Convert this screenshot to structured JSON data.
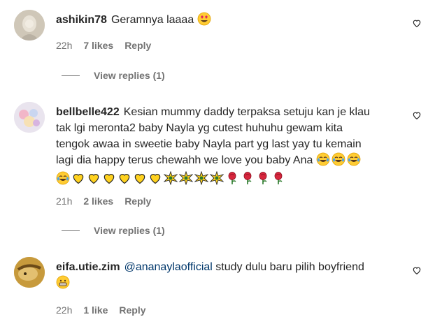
{
  "comments": [
    {
      "username": "ashikin78",
      "text": "Geramnya laaaa",
      "time": "22h",
      "likes": "7 likes",
      "reply": "Reply",
      "view_replies": "View replies (1)"
    },
    {
      "username": "bellbelle422",
      "text": "Kesian mummy daddy terpaksa setuju kan je klau tak lgi meronta2 baby Nayla yg cutest huhuhu gewam kita tengok awaa in sweetie baby Nayla part yg last yay tu kemain lagi dia happy terus chewahh we love you baby Ana",
      "time": "21h",
      "likes": "2 likes",
      "reply": "Reply",
      "view_replies": "View replies (1)"
    },
    {
      "username": "eifa.utie.zim",
      "mention": "@ananaylaofficial",
      "text": "study dulu baru pilih boyfriend",
      "time": "22h",
      "likes": "1 like",
      "reply": "Reply"
    }
  ],
  "icons": {
    "heart": "heart-outline-icon",
    "heart_eyes": "heart-eyes-emoji",
    "joy": "tears-of-joy-emoji",
    "yellow_heart": "yellow-heart-emoji",
    "sparkle": "sparkle-emoji",
    "rose": "rose-emoji",
    "grin": "grinning-emoji"
  },
  "colors": {
    "text": "#262626",
    "muted": "#737373",
    "mention": "#00376b"
  }
}
